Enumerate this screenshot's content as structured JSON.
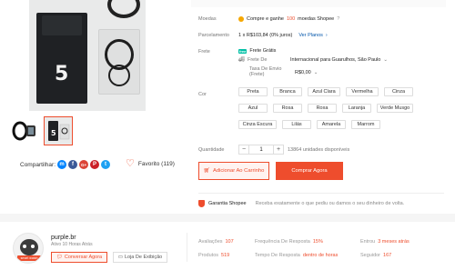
{
  "details": {
    "moedas_label": "Moedas",
    "moedas_prefix": "Compre e ganhe",
    "moedas_amount": "100",
    "moedas_suffix": "moedas Shopee",
    "moedas_help": "?",
    "parcelamento_label": "Parcelamento",
    "parcelamento_value": "1 x R$103,84 (0% juros)",
    "parcelamento_link": "Ver Planos",
    "frete_label": "Frete",
    "frete_badge": "free",
    "frete_gratis": "Frete Grátis",
    "frete_de_label": "Frete De",
    "frete_de_value": "Internacional para Guarulhos, São Paulo",
    "taxa_label_1": "Taxa De Envio",
    "taxa_label_2": "(Frete)",
    "taxa_value": "R$0,00",
    "cor_label": "Cor",
    "colors": [
      "Preta",
      "Branca",
      "Azul Clara",
      "Vermelha",
      "Cinza",
      "Azul",
      "Rosa",
      "Roxa",
      "Laranja",
      "Verde Musgo",
      "Cinza Escura",
      "Lilás",
      "Amarela",
      "Marrom"
    ],
    "quantidade_label": "Quantidade",
    "quantity_minus": "−",
    "quantity_value": "1",
    "quantity_plus": "+",
    "stock": "13864 unidades disponíveis",
    "add_to_cart": "Adicionar Ao Carrinho",
    "buy_now": "Comprar Agora",
    "guarantee_title": "Garantia Shopee",
    "guarantee_text": "Receba exatamente o que pediu ou damos o seu dinheiro de volta."
  },
  "gallery": {
    "box_number": "5",
    "share_label": "Compartilhar:",
    "social": [
      "m",
      "f",
      "G+",
      "P",
      "t"
    ],
    "favorite_label": "Favorito (119)"
  },
  "shop": {
    "avatar_tag": "smart watch",
    "name": "purple.br",
    "active": "Ativo 10 Horas Atrás",
    "chat_button": "Conversar Agora",
    "store_button": "Loja De Exibição",
    "stats": [
      {
        "label": "Avaliações",
        "value": "107"
      },
      {
        "label": "Frequência De Resposta",
        "value": "15%"
      },
      {
        "label": "Entrou",
        "value": "3 meses atrás"
      },
      {
        "label": "Produtos",
        "value": "519"
      },
      {
        "label": "Tempo De Resposta",
        "value": "dentro de horas"
      },
      {
        "label": "Seguidor",
        "value": "167"
      }
    ]
  },
  "colors": {
    "accent": "#ee4d2d",
    "free_shipping": "#00bfa5",
    "coin": "#f6a700",
    "link": "#0055aa"
  }
}
